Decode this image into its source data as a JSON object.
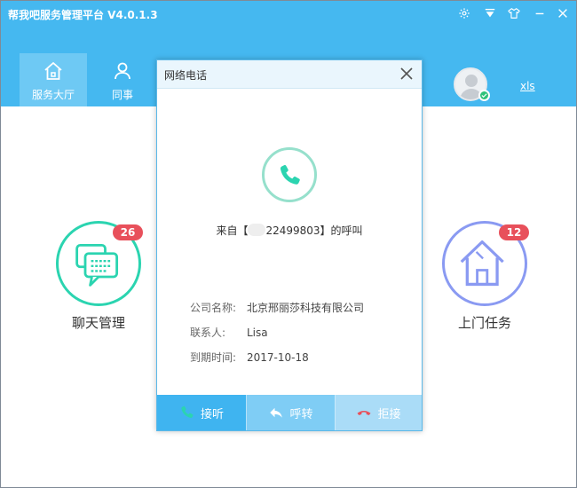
{
  "app": {
    "title": "帮我吧服务管理平台 V4.0.1.3",
    "window_controls": [
      "gear-icon",
      "dropdown-icon",
      "shirt-icon",
      "minimize-icon",
      "close-icon"
    ]
  },
  "nav": {
    "tabs": [
      {
        "label": "服务大厅",
        "icon": "home-icon",
        "active": true
      },
      {
        "label": "同事",
        "icon": "user-icon",
        "active": false
      }
    ]
  },
  "user": {
    "name": "xls",
    "status": "online"
  },
  "features": [
    {
      "label": "聊天管理",
      "badge": "26",
      "icon": "chat-icon",
      "color": "#2bd4b0"
    },
    {
      "label": "上门任务",
      "badge": "12",
      "icon": "house-icon",
      "color": "#8a9af2"
    }
  ],
  "dialog": {
    "title": "网络电话",
    "caller_prefix": "来自【",
    "caller_number": "22499803",
    "caller_suffix": "】的呼叫",
    "fields": [
      {
        "key": "公司名称:",
        "value": "北京邢丽莎科技有限公司"
      },
      {
        "key": "联系人:",
        "value": "Lisa"
      },
      {
        "key": "到期时间:",
        "value": "2017-10-18"
      }
    ],
    "buttons": {
      "accept": "接听",
      "transfer": "呼转",
      "reject": "拒接"
    }
  },
  "colors": {
    "header": "#45b8f0",
    "accept": "#3fb4f0",
    "chat": "#2bd4b0",
    "task": "#8a9af2",
    "badge": "#e8505b"
  }
}
